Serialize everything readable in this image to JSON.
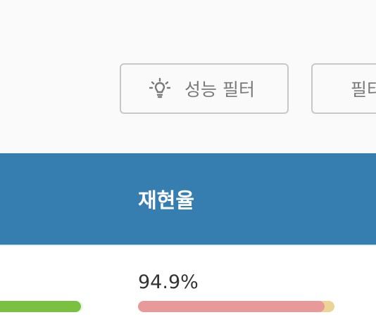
{
  "filters": {
    "performance_label": "성능 필터",
    "performance_icon": "lightbulb-icon",
    "other_label": "필터"
  },
  "table": {
    "recall_header": "재현율"
  },
  "row": {
    "recall_text": "94.9%",
    "recall_fraction": 0.949,
    "left_bar_fraction": 0.98
  },
  "colors": {
    "header": "#377eb0",
    "bar_good": "#7ac143",
    "bar_recall": "#e89a9a",
    "bar_track": "#ead597"
  }
}
